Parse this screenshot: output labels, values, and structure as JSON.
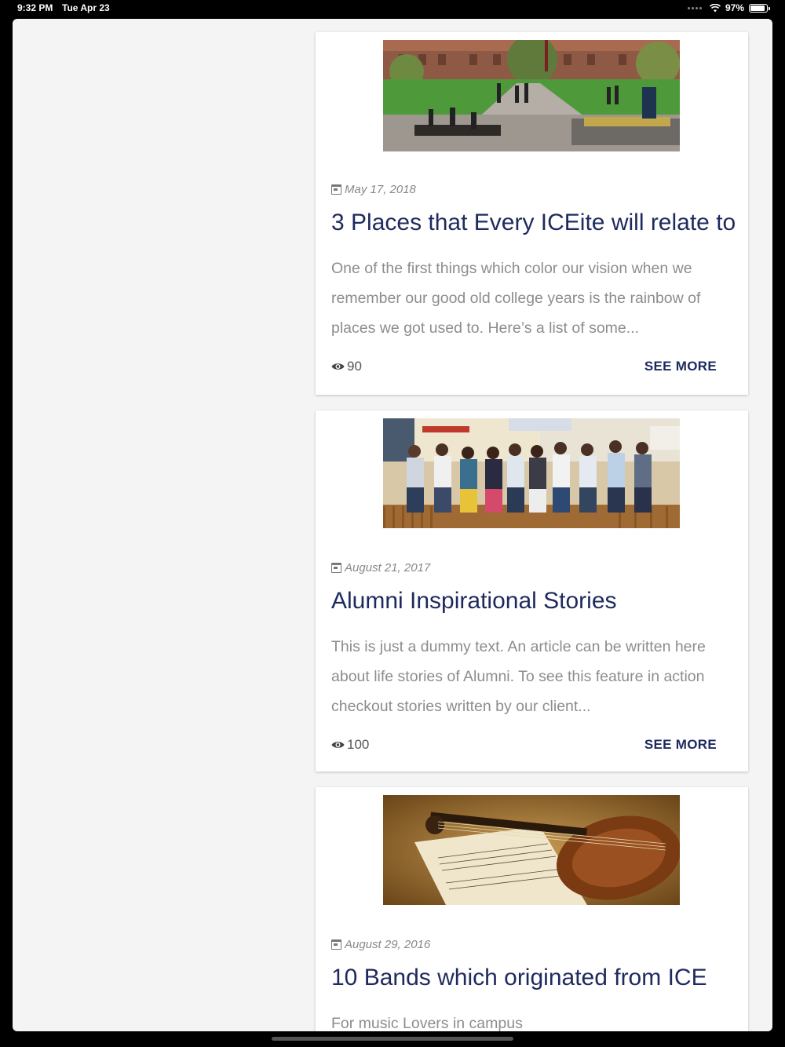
{
  "status_bar": {
    "time": "9:32 PM",
    "date": "Tue Apr 23",
    "battery": "97%"
  },
  "posts": [
    {
      "date": "May 17, 2018",
      "title": "3 Places that Every ICEite will relate to",
      "excerpt": "One of the first things which color our vision when we remember our good old college years is the rainbow of places we got used to. Here’s a list of some...",
      "views": "90",
      "action": "SEE MORE"
    },
    {
      "date": "August 21, 2017",
      "title": "Alumni Inspirational Stories",
      "excerpt": "This is just a dummy text. An article can be written here about life stories of Alumni. To see this feature in action checkout stories written by our client...",
      "views": "100",
      "action": "SEE MORE"
    },
    {
      "date": "August 29, 2016",
      "title": "10 Bands which originated from ICE",
      "excerpt": "For music Lovers in campus"
    }
  ]
}
